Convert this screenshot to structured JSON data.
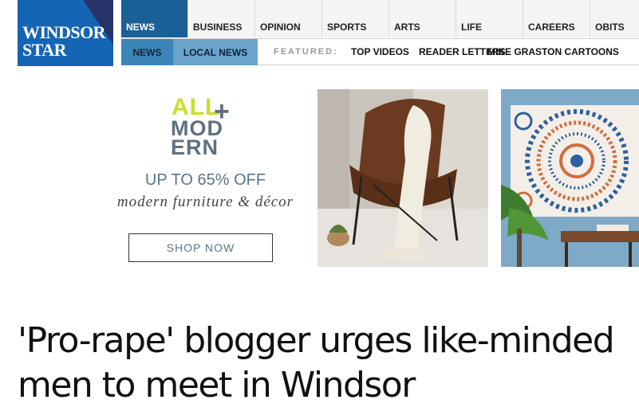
{
  "logo": {
    "line1": "WINDSOR",
    "line2": "STAR"
  },
  "top_nav": [
    {
      "label": "NEWS",
      "active": true
    },
    {
      "label": "BUSINESS"
    },
    {
      "label": "OPINION"
    },
    {
      "label": "SPORTS"
    },
    {
      "label": "ARTS"
    },
    {
      "label": "LIFE"
    },
    {
      "label": "CAREERS"
    },
    {
      "label": "OBITS"
    }
  ],
  "sub_nav": {
    "news": "NEWS",
    "local_news": "LOCAL NEWS",
    "featured_label": "FEATURED:",
    "links": [
      "TOP VIDEOS",
      "READER LETTERS",
      "MIKE GRASTON CARTOONS"
    ]
  },
  "ad": {
    "brand_all": "ALL",
    "brand_plus": "+",
    "brand_mod": "MOD",
    "brand_ern": "ERN",
    "offer": "UP TO 65% OFF",
    "subtitle": "modern furniture & décor",
    "cta": "SHOP NOW"
  },
  "article": {
    "headline": "'Pro-rape' blogger urges like-minded men to meet in Windsor"
  },
  "colors": {
    "brand_blue": "#1565b5",
    "nav_active": "#1b5f97",
    "subnav_local": "#6aa4cb",
    "ad_lime": "#c9df2a",
    "ad_slate": "#607080"
  }
}
